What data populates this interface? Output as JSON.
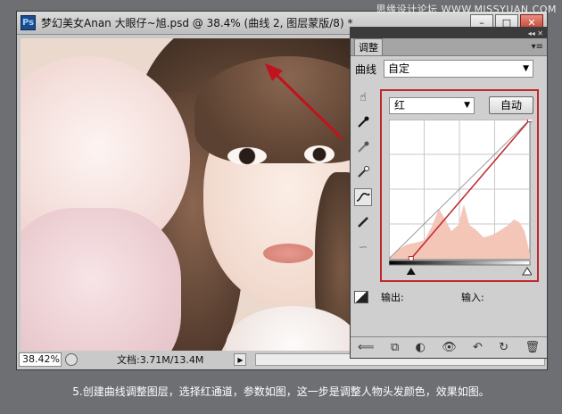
{
  "watermark": "思缘设计论坛 WWW.MISSYUAN.COM",
  "window": {
    "title": "梦幻美女Anan 大眼仔~旭.psd @ 38.4% (曲线 2, 图层蒙版/8) *",
    "app_icon_label": "Ps",
    "controls": {
      "minimize": "–",
      "maximize": "□",
      "close": "✕"
    }
  },
  "statusbar": {
    "zoom": "38.42%",
    "doc_info": "文档:3.71M/13.4M",
    "arrow": "▶"
  },
  "panel": {
    "top_icons": "◂◂ ✕",
    "tab": "调整",
    "menu_icon": "▾≡",
    "preset_label": "曲线",
    "preset_value": "自定",
    "channel_value": "红",
    "auto_button": "自动",
    "output_label": "输出:",
    "input_label": "输入:",
    "tools": [
      "hand-adjust-icon",
      "eyedropper-black-icon",
      "eyedropper-gray-icon",
      "eyedropper-white-icon",
      "curve-point-icon",
      "pencil-icon",
      "smooth-icon"
    ],
    "bottom_icons": [
      "back-icon",
      "clip-icon",
      "visibility-toggle-icon",
      "eye-icon",
      "view-previous-icon",
      "reset-icon",
      "trash-icon"
    ]
  },
  "curve": {
    "channel_color": "#c1272d",
    "input_black": 40,
    "output_black": 0,
    "input_white": 255,
    "output_white": 255
  },
  "caption": "5.创建曲线调整图层，选择红通道，参数如图，这一步是调整人物头发颜色，效果如图。"
}
